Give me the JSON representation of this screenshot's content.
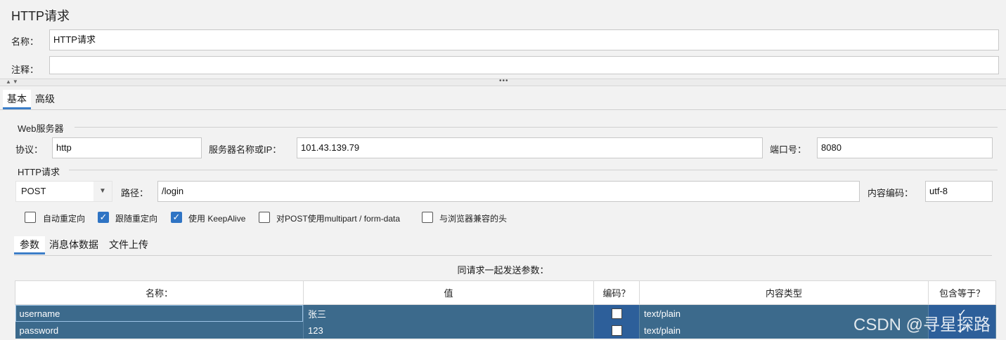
{
  "title": "HTTP请求",
  "name_label": "名称：",
  "name_value": "HTTP请求",
  "comment_label": "注释：",
  "comment_value": "",
  "tabs": [
    "基本",
    "高级"
  ],
  "web_server": {
    "group_label": "Web服务器",
    "protocol_label": "协议：",
    "protocol_value": "http",
    "server_label": "服务器名称或IP：",
    "server_value": "101.43.139.79",
    "port_label": "端口号：",
    "port_value": "8080"
  },
  "http_request": {
    "group_label": "HTTP请求",
    "method": "POST",
    "path_label": "路径：",
    "path_value": "/login",
    "encoding_label": "内容编码：",
    "encoding_value": "utf-8"
  },
  "options": [
    {
      "label": "自动重定向",
      "checked": false
    },
    {
      "label": "跟随重定向",
      "checked": true
    },
    {
      "label": "使用 KeepAlive",
      "checked": true
    },
    {
      "label": "对POST使用multipart / form-data",
      "checked": false
    },
    {
      "label": "与浏览器兼容的头",
      "checked": false
    }
  ],
  "sub_tabs": [
    "参数",
    "消息体数据",
    "文件上传"
  ],
  "params_caption": "同请求一起发送参数：",
  "table": {
    "headers": [
      "名称：",
      "值",
      "编码？",
      "内容类型",
      "包含等于？"
    ],
    "rows": [
      {
        "name": "username",
        "value": "张三",
        "encode": false,
        "content_type": "text/plain",
        "include_equals": true
      },
      {
        "name": "password",
        "value": "123",
        "encode": false,
        "content_type": "text/plain",
        "include_equals": true
      }
    ]
  },
  "watermark": "CSDN @寻星探路",
  "colors": {
    "accent": "#3c7ec8",
    "selection": "#3c6a8c",
    "checkbox_checked": "#2f74c4"
  }
}
